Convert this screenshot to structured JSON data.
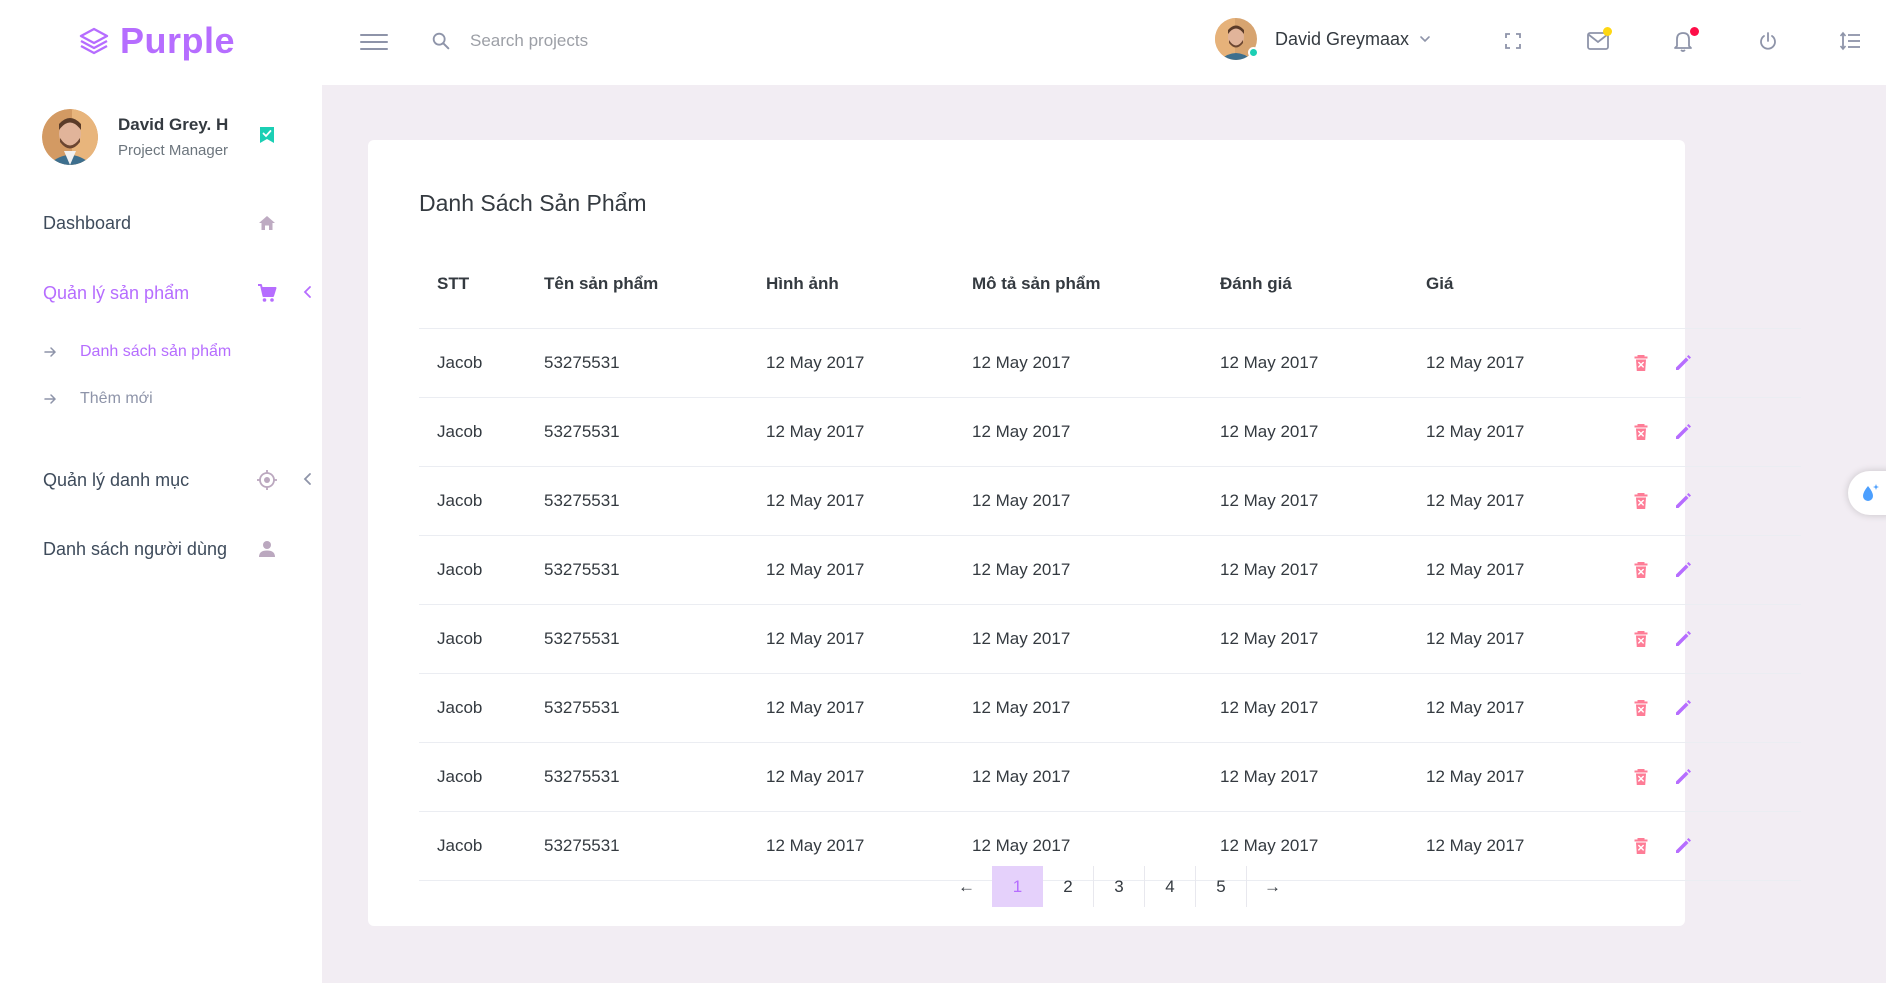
{
  "brand": {
    "name": "Purple"
  },
  "search": {
    "placeholder": "Search projects"
  },
  "header_user": {
    "name": "David Greymaax"
  },
  "sidebar": {
    "profile": {
      "name": "David Grey. H",
      "role": "Project Manager"
    },
    "items": [
      {
        "label": "Dashboard",
        "icon": "home-icon"
      },
      {
        "label": "Quản lý sản phẩm",
        "icon": "cart-icon",
        "active": true,
        "children": [
          {
            "label": "Danh sách sản phẩm",
            "active": true
          },
          {
            "label": "Thêm mới"
          }
        ]
      },
      {
        "label": "Quản lý danh mục",
        "icon": "crosshair-icon"
      },
      {
        "label": "Danh sách người dùng",
        "icon": "user-icon"
      }
    ]
  },
  "main": {
    "title": "Danh Sách Sản Phẩm",
    "table": {
      "headers": [
        "STT",
        "Tên sản phẩm",
        "Hình ảnh",
        "Mô tả sản phẩm",
        "Đánh giá",
        "Giá"
      ],
      "rows": [
        [
          "Jacob",
          "53275531",
          "12 May 2017",
          "12 May 2017",
          "12 May 2017",
          "12 May 2017"
        ],
        [
          "Jacob",
          "53275531",
          "12 May 2017",
          "12 May 2017",
          "12 May 2017",
          "12 May 2017"
        ],
        [
          "Jacob",
          "53275531",
          "12 May 2017",
          "12 May 2017",
          "12 May 2017",
          "12 May 2017"
        ],
        [
          "Jacob",
          "53275531",
          "12 May 2017",
          "12 May 2017",
          "12 May 2017",
          "12 May 2017"
        ],
        [
          "Jacob",
          "53275531",
          "12 May 2017",
          "12 May 2017",
          "12 May 2017",
          "12 May 2017"
        ],
        [
          "Jacob",
          "53275531",
          "12 May 2017",
          "12 May 2017",
          "12 May 2017",
          "12 May 2017"
        ],
        [
          "Jacob",
          "53275531",
          "12 May 2017",
          "12 May 2017",
          "12 May 2017",
          "12 May 2017"
        ],
        [
          "Jacob",
          "53275531",
          "12 May 2017",
          "12 May 2017",
          "12 May 2017",
          "12 May 2017"
        ]
      ]
    },
    "pagination": {
      "pages": [
        "1",
        "2",
        "3",
        "4",
        "5"
      ],
      "current": "1",
      "prev": "←",
      "next": "→"
    }
  },
  "colors": {
    "accent": "#b66dff",
    "delete": "#fe7c96",
    "active_page_bg": "#e5d1fb",
    "background": "#f2edf3",
    "online": "#1bcfb4",
    "mail_badge": "#fed713",
    "bell_badge": "#fe0e48"
  }
}
